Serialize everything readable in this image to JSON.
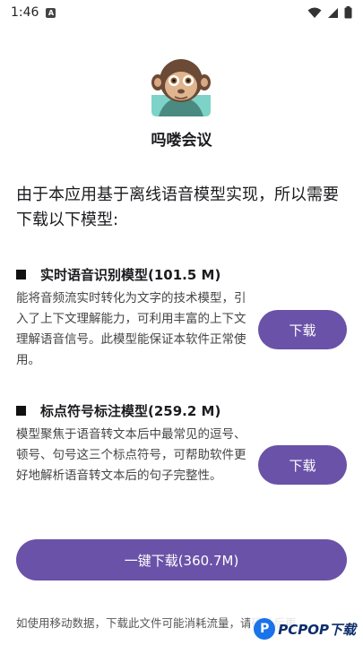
{
  "status_bar": {
    "time": "1:46"
  },
  "app": {
    "title": "吗喽会议"
  },
  "intro": {
    "text": "由于本应用基于离线语音模型实现，所以需要下载以下模型:"
  },
  "models": [
    {
      "title": "实时语音识别模型(101.5 M)",
      "description": "能将音频流实时转化为文字的技术模型，引入了上下文理解能力，可利用丰富的上下文理解语音信号。此模型能保证本软件正常使用。",
      "button_label": "下载"
    },
    {
      "title": "标点符号标注模型(259.2 M)",
      "description": "模型聚焦于语音转文本后中最常见的逗号、顿号、句号这三个标点符号，可帮助软件更好地解析语音转文本后的句子完整性。",
      "button_label": "下载"
    }
  ],
  "download_all": {
    "label": "一键下载(360.7M)"
  },
  "footer": {
    "note": "如使用移动数据，下载此文件可能消耗流量，请确认后再"
  },
  "watermark": {
    "text": "PCPOP下载"
  },
  "colors": {
    "accent": "#6a52a8",
    "text": "#1c1b1f"
  }
}
